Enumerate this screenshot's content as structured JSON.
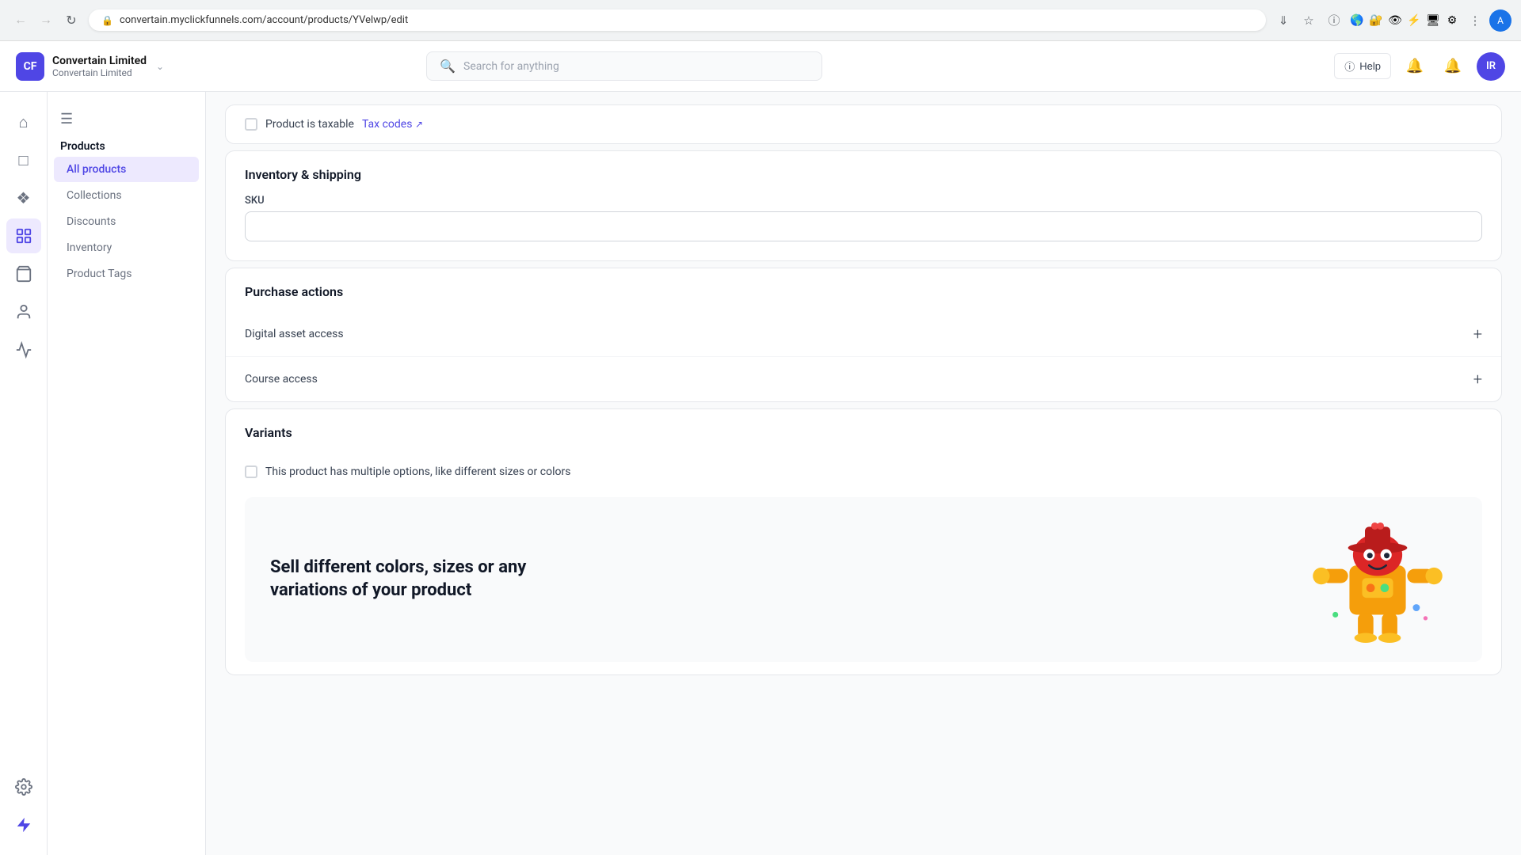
{
  "browser": {
    "url": "convertain.myclickfunnels.com/account/products/YVelwp/edit",
    "url_full": "convertain.myclickfunnels.com/account/products/YVelwp/edit"
  },
  "brand": {
    "name": "Convertain Limited",
    "sub": "Convertain Limited",
    "icon_text": "CF"
  },
  "search": {
    "placeholder": "Search for anything"
  },
  "topbar": {
    "help_label": "Help"
  },
  "user": {
    "initials": "IR"
  },
  "sidebar": {
    "menu_title": "Products",
    "items": [
      {
        "label": "Products",
        "id": "products",
        "active": false
      },
      {
        "label": "All products",
        "id": "all-products",
        "active": true
      },
      {
        "label": "Collections",
        "id": "collections",
        "active": false
      },
      {
        "label": "Discounts",
        "id": "discounts",
        "active": false
      },
      {
        "label": "Inventory",
        "id": "inventory",
        "active": false
      },
      {
        "label": "Product Tags",
        "id": "product-tags",
        "active": false
      }
    ]
  },
  "page": {
    "tax_label": "Product is taxable",
    "tax_link_label": "Tax codes",
    "inventory_section_title": "Inventory & shipping",
    "sku_label": "SKU",
    "sku_placeholder": "",
    "purchase_actions_title": "Purchase actions",
    "digital_asset_access_label": "Digital asset access",
    "course_access_label": "Course access",
    "variants_section_title": "Variants",
    "variants_checkbox_label": "This product has multiple options, like different sizes or colors",
    "promo_title": "Sell different colors, sizes or any variations of your product"
  }
}
